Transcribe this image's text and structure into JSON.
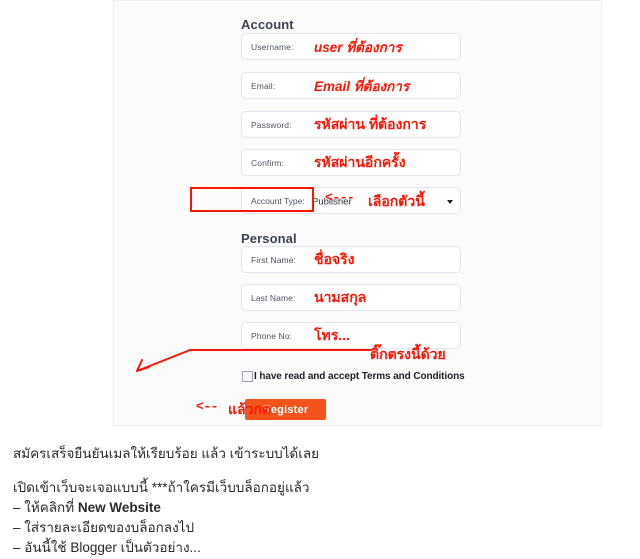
{
  "form": {
    "account_section": {
      "heading": "Account",
      "fields": [
        {
          "label": "Username:",
          "value": "user ที่ต้องการ",
          "italic": true
        },
        {
          "label": "Email:",
          "value": "Email ที่ต้องการ",
          "italic": true
        },
        {
          "label": "Password:",
          "value": "รหัสผ่าน ที่ต้องการ",
          "italic": false
        },
        {
          "label": "Confirm:",
          "value": "รหัสผ่านอีกครั้ง",
          "italic": false
        }
      ],
      "account_type": {
        "label": "Account Type:",
        "selected": "Publisher"
      }
    },
    "personal_section": {
      "heading": "Personal",
      "fields": [
        {
          "label": "First Name:",
          "value": "ชื่อจริง"
        },
        {
          "label": "Last Name:",
          "value": "นามสกุล"
        },
        {
          "label": "Phone No:",
          "value": "โทร..."
        }
      ]
    },
    "terms": {
      "label": "I have read and accept Terms and Conditions",
      "checked": false
    },
    "submit": {
      "label": "Register"
    }
  },
  "annotations": {
    "select_dashes": "<---",
    "select_text": "เลือกตัวนี้",
    "checkbox_text": "ติ๊กตรงนี้ด้วย",
    "press_dashes": "<--",
    "press_text": "แล้วกด"
  },
  "bottom_copy": {
    "paragraph_1": "สมัครเสร็จยืนยันเมลให้เรียบร้อย แล้ว เข้าระบบได้เลย",
    "paragraph_2": [
      {
        "text": "เปิดเข้าเว็บจะเจอแบบนี้ ***ถ้าใครมีเว็บบล็อกอยู่แล้ว",
        "strong_tail": ""
      },
      {
        "text": "– ให้คลิกที่ ",
        "strong_tail": "New Website"
      },
      {
        "text": "– ใส่รายละเอียดของบล็อกลงไป",
        "strong_tail": ""
      },
      {
        "text": "– อันนี้ใช้ Blogger เป็นตัวอย่าง...",
        "strong_tail": ""
      }
    ]
  },
  "colors": {
    "accent_red": "#fb1705",
    "register_orange": "#f2541b",
    "field_border": "#e4e4ef",
    "panel_bg": "#fcfcfc"
  }
}
